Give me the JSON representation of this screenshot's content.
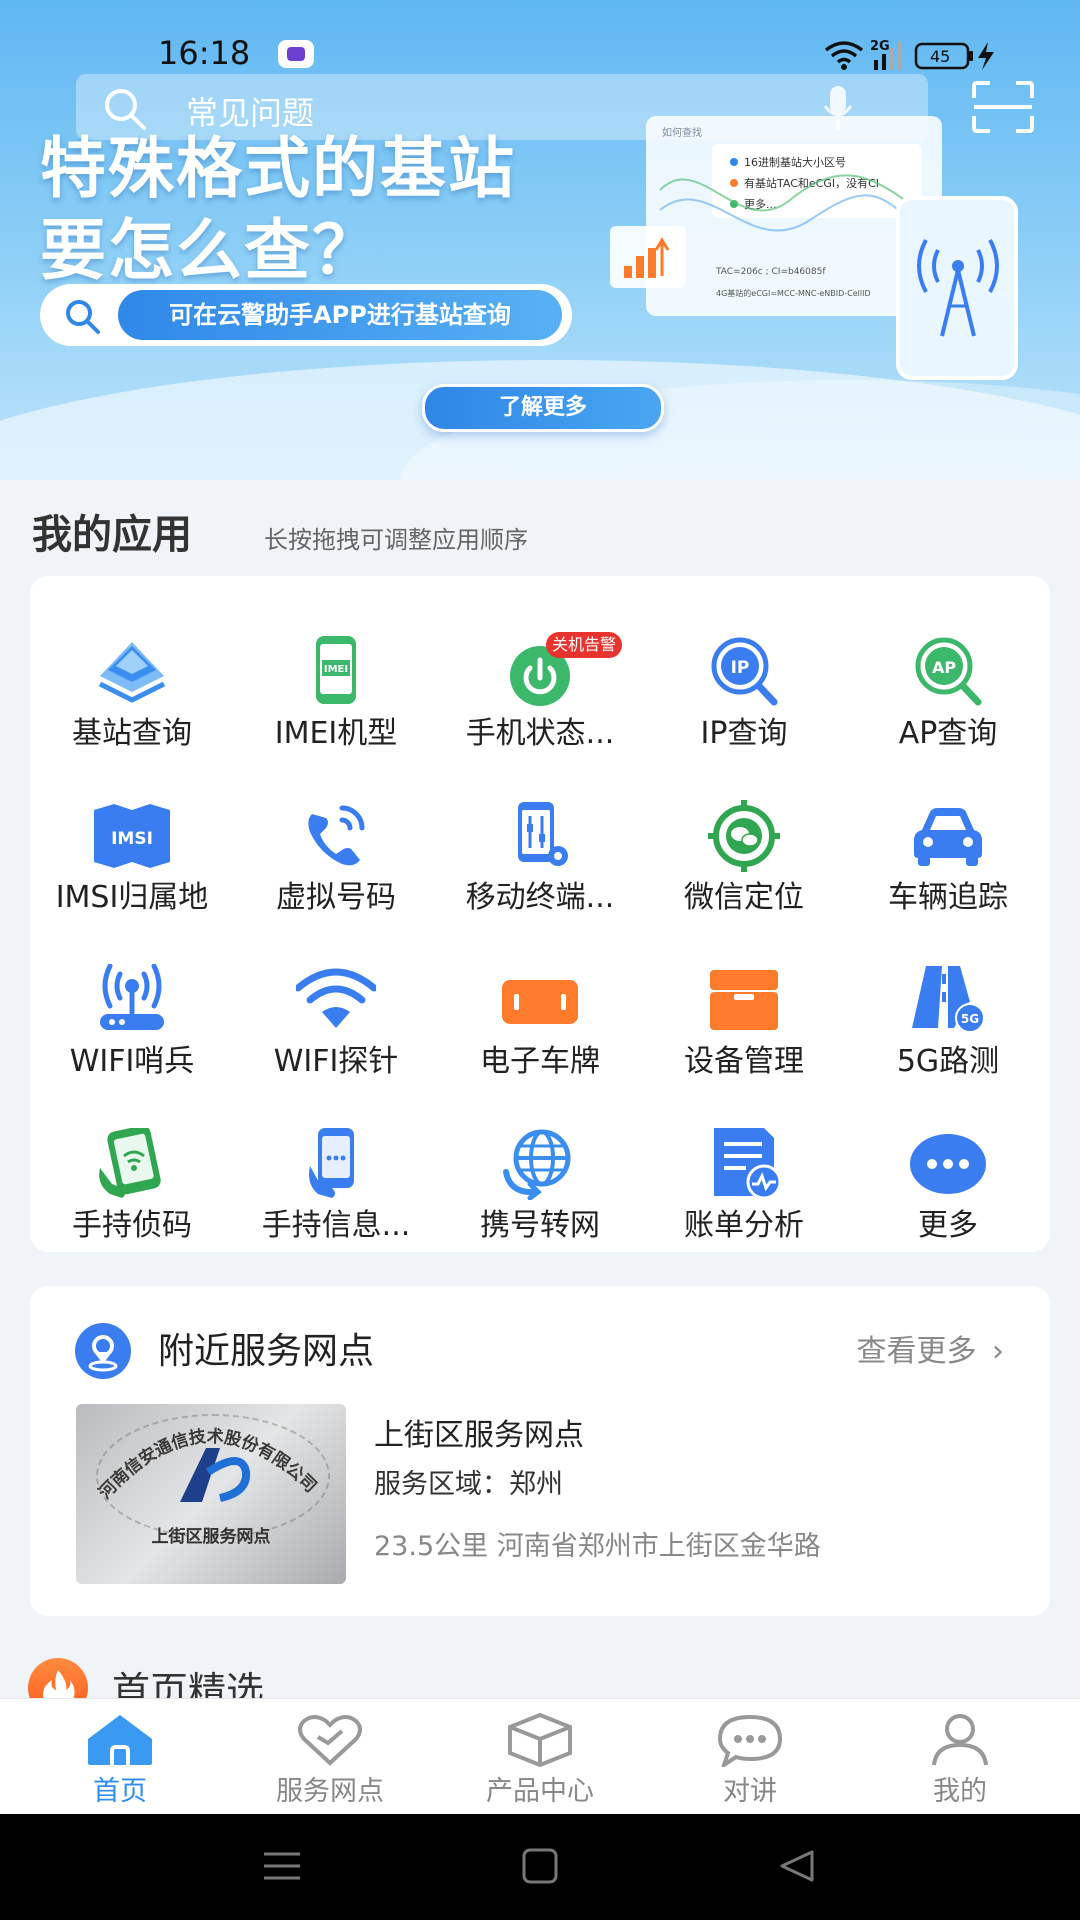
{
  "status_bar": {
    "time": "16:18",
    "network": "2G",
    "battery": "45"
  },
  "banner": {
    "search_placeholder": "常见问题",
    "headline_line1": "特殊格式的基站",
    "headline_line2": "要怎么查？",
    "pill_text": "可在云警助手APP进行基站查询",
    "learn_more": "了解更多",
    "illus_header": "如何查找",
    "illus_items": [
      "16进制基站大小区号",
      "有基站TAC和eCGI，没有CI",
      "更多..."
    ],
    "illus_line1": "TAC=206c ; CI=b46085f",
    "illus_line2": "4G基站的eCGI=MCC-MNC-eNBID-CellID"
  },
  "apps_section": {
    "title": "我的应用",
    "subtitle": "长按拖拽可调整应用顺序"
  },
  "apps": [
    {
      "label": "基站查询",
      "icon": "layers-icon",
      "color": "#3a8ef0"
    },
    {
      "label": "IMEI机型",
      "icon": "phone-imei-icon",
      "color": "#3bb86a"
    },
    {
      "label": "手机状态...",
      "icon": "power-status-icon",
      "color": "#3bb86a",
      "badge": "关机告警"
    },
    {
      "label": "IP查询",
      "icon": "ip-search-icon",
      "color": "#3a7df0"
    },
    {
      "label": "AP查询",
      "icon": "ap-search-icon",
      "color": "#3bb86a"
    },
    {
      "label": "IMSI归属地",
      "icon": "imsi-map-icon",
      "color": "#3a7df0"
    },
    {
      "label": "虚拟号码",
      "icon": "phone-call-icon",
      "color": "#3a7df0"
    },
    {
      "label": "移动终端...",
      "icon": "terminal-settings-icon",
      "color": "#3a7df0"
    },
    {
      "label": "微信定位",
      "icon": "wechat-target-icon",
      "color": "#2fa64f"
    },
    {
      "label": "车辆追踪",
      "icon": "car-icon",
      "color": "#3a7df0"
    },
    {
      "label": "WIFI哨兵",
      "icon": "wifi-router-icon",
      "color": "#3a7df0"
    },
    {
      "label": "WIFI探针",
      "icon": "wifi-icon",
      "color": "#3a7df0"
    },
    {
      "label": "电子车牌",
      "icon": "license-plate-icon",
      "color": "#ff7b2c"
    },
    {
      "label": "设备管理",
      "icon": "device-box-icon",
      "color": "#ff7b2c"
    },
    {
      "label": "5G路测",
      "icon": "road-5g-icon",
      "color": "#3a7df0"
    },
    {
      "label": "手持侦码",
      "icon": "handheld-detect-icon",
      "color": "#2fa64f"
    },
    {
      "label": "手持信息...",
      "icon": "handheld-info-icon",
      "color": "#3a7df0"
    },
    {
      "label": "携号转网",
      "icon": "globe-transfer-icon",
      "color": "#3a8ef0"
    },
    {
      "label": "账单分析",
      "icon": "bill-analysis-icon",
      "color": "#3a7df0"
    },
    {
      "label": "更多",
      "icon": "more-icon",
      "color": "#3a7df0"
    }
  ],
  "nearby": {
    "title": "附近服务网点",
    "more": "查看更多",
    "name": "上街区服务网点",
    "area_label": "服务区域：",
    "area_value": "郑州",
    "address": "23.5公里 河南省郑州市上街区金华路",
    "image_caption": "上街区服务网点",
    "image_ring_text": "河南信安通信技术股份有限公司"
  },
  "featured": {
    "title": "首页精选"
  },
  "tabs": [
    {
      "label": "首页",
      "icon": "home-icon",
      "active": true
    },
    {
      "label": "服务网点",
      "icon": "heart-icon",
      "active": false
    },
    {
      "label": "产品中心",
      "icon": "box-icon",
      "active": false
    },
    {
      "label": "对讲",
      "icon": "chat-bubble-icon",
      "active": false
    },
    {
      "label": "我的",
      "icon": "user-icon",
      "active": false
    }
  ],
  "colors": {
    "accent": "#2b8ef0",
    "alarm": "#e8332f",
    "orange": "#ff7b2c",
    "green": "#3bb86a"
  }
}
